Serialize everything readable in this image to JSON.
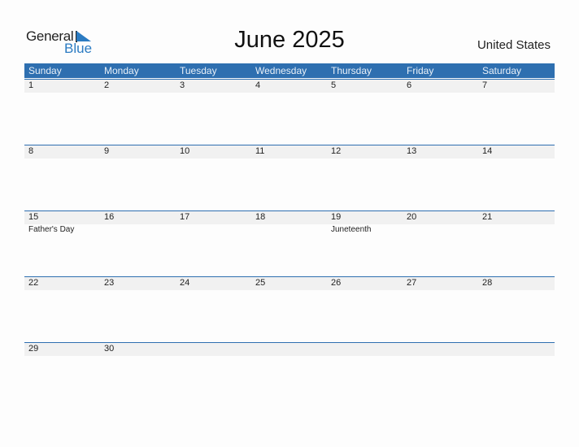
{
  "logo": {
    "word1": "General",
    "word2": "Blue"
  },
  "title": "June 2025",
  "country": "United States",
  "colors": {
    "accent": "#2e6fb0",
    "band": "#f1f1f1"
  },
  "weekdays": [
    "Sunday",
    "Monday",
    "Tuesday",
    "Wednesday",
    "Thursday",
    "Friday",
    "Saturday"
  ],
  "weeks": [
    {
      "days": [
        "1",
        "2",
        "3",
        "4",
        "5",
        "6",
        "7"
      ],
      "holidays": [
        "",
        "",
        "",
        "",
        "",
        "",
        ""
      ]
    },
    {
      "days": [
        "8",
        "9",
        "10",
        "11",
        "12",
        "13",
        "14"
      ],
      "holidays": [
        "",
        "",
        "",
        "",
        "",
        "",
        ""
      ]
    },
    {
      "days": [
        "15",
        "16",
        "17",
        "18",
        "19",
        "20",
        "21"
      ],
      "holidays": [
        "Father's Day",
        "",
        "",
        "",
        "Juneteenth",
        "",
        ""
      ]
    },
    {
      "days": [
        "22",
        "23",
        "24",
        "25",
        "26",
        "27",
        "28"
      ],
      "holidays": [
        "",
        "",
        "",
        "",
        "",
        "",
        ""
      ]
    },
    {
      "days": [
        "29",
        "30",
        "",
        "",
        "",
        "",
        ""
      ],
      "holidays": [
        "",
        "",
        "",
        "",
        "",
        "",
        ""
      ]
    }
  ]
}
